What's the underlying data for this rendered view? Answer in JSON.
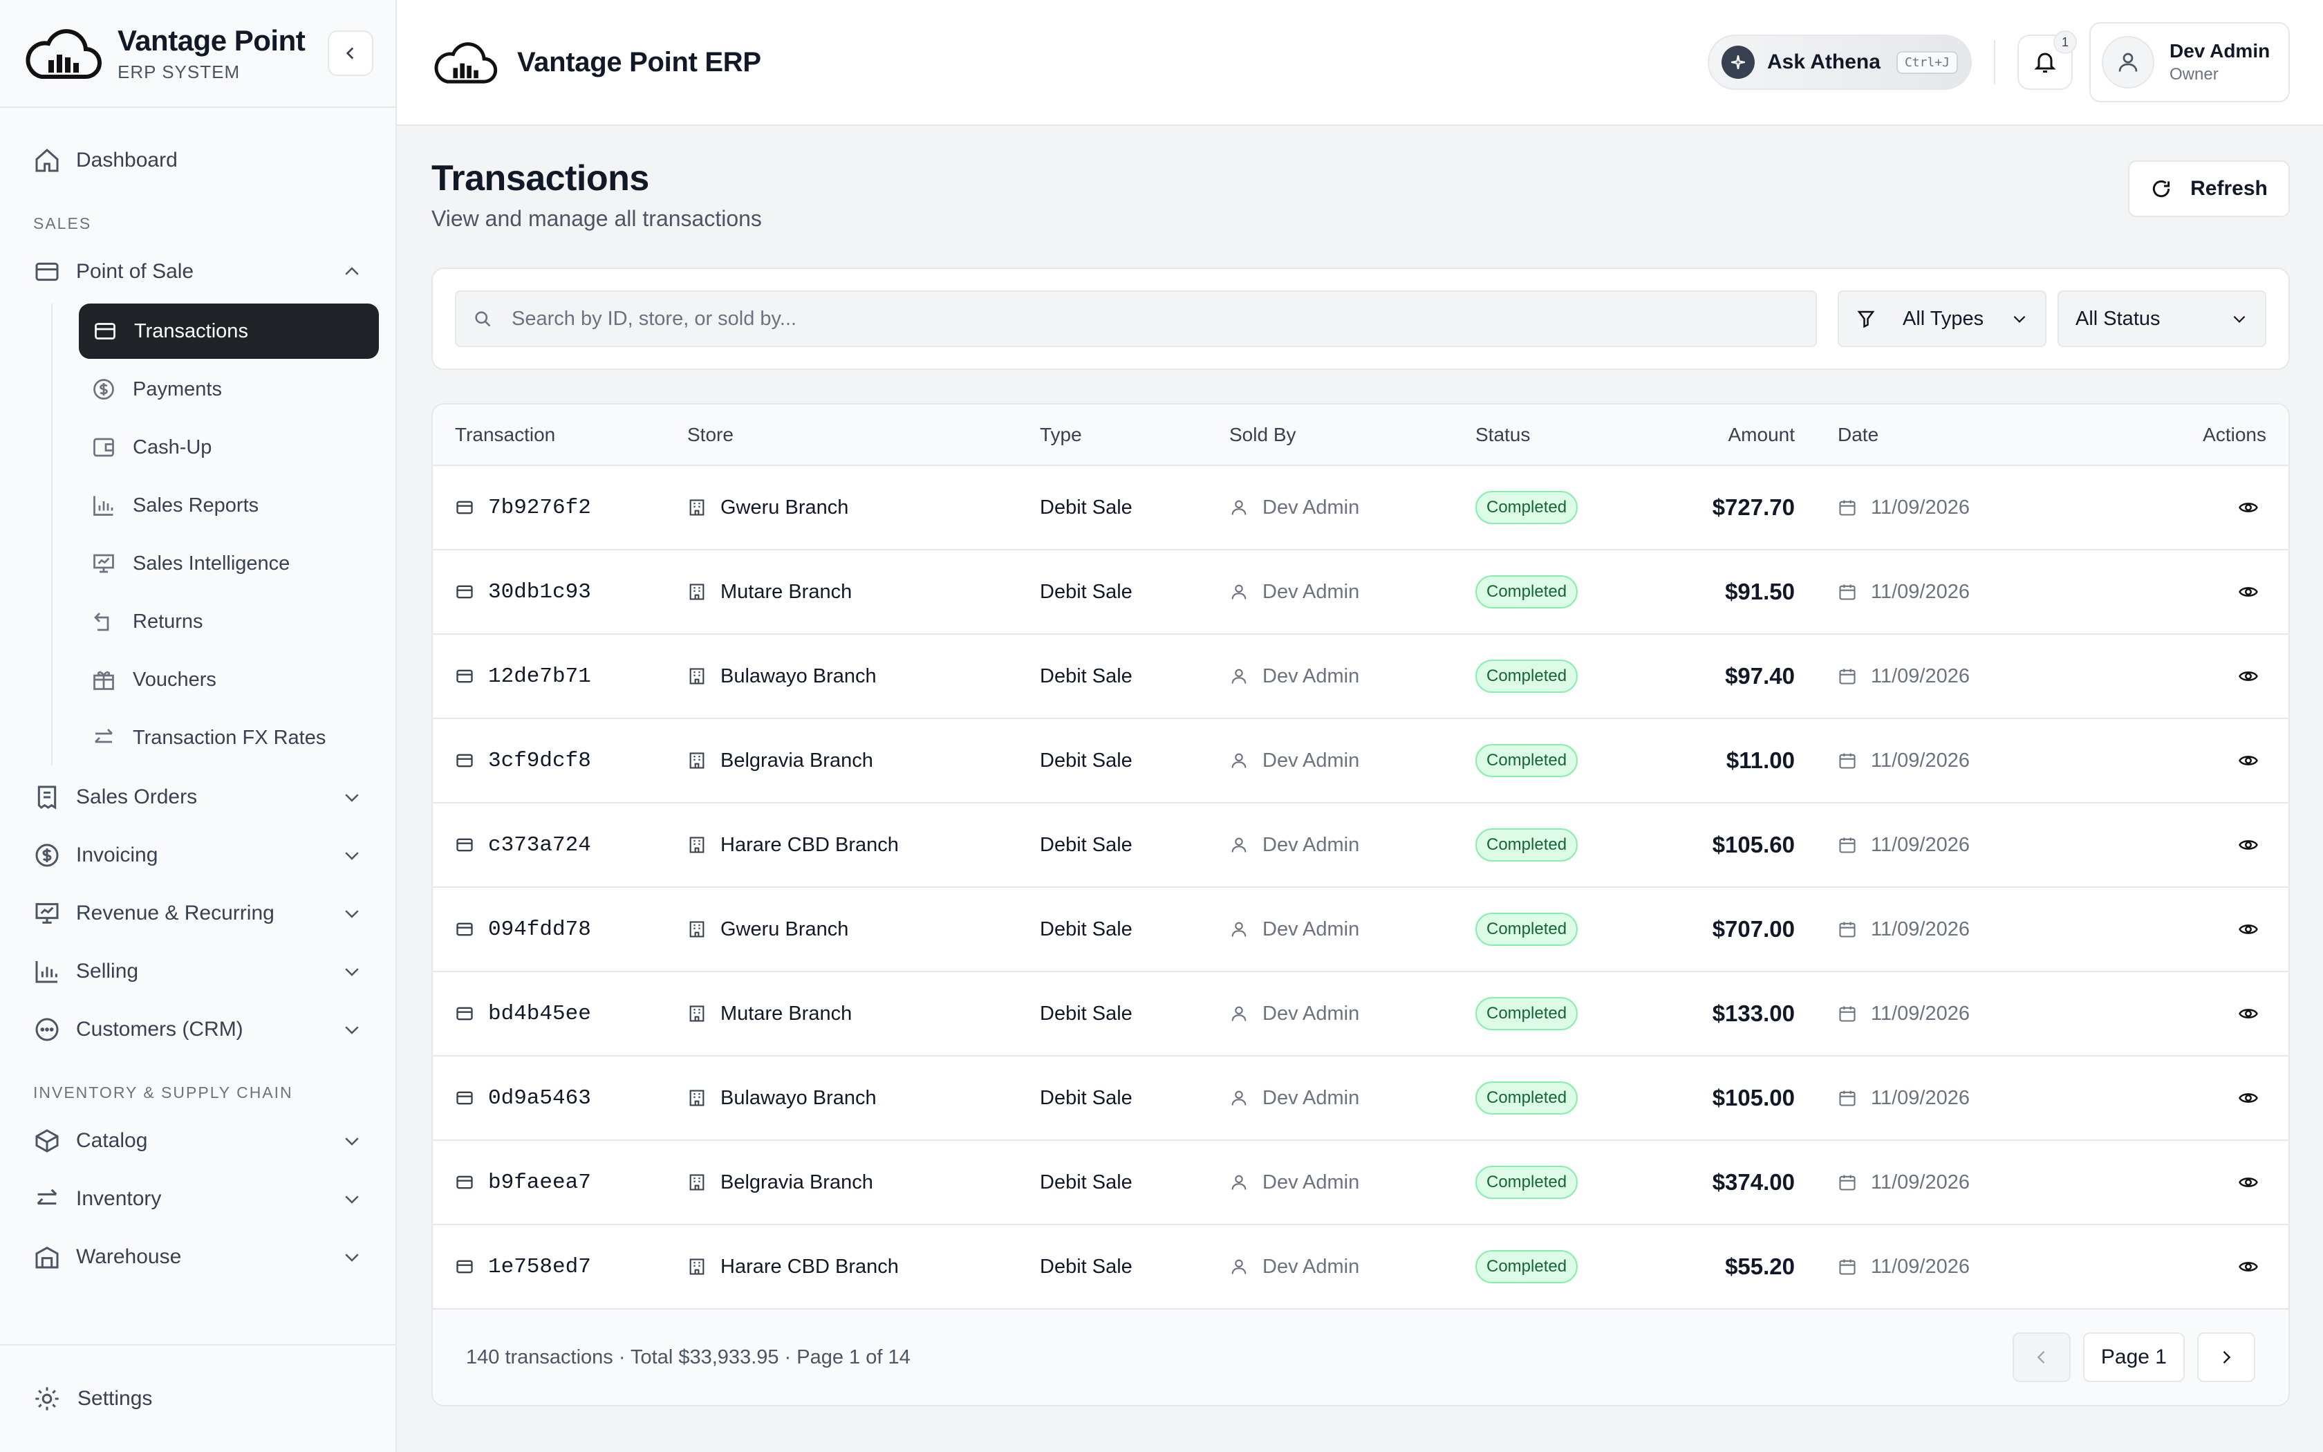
{
  "brand": {
    "name": "Vantage Point",
    "subtitle": "ERP SYSTEM"
  },
  "sidebar": {
    "dashboard": "Dashboard",
    "sections": {
      "sales": "SALES",
      "inventory": "INVENTORY & SUPPLY CHAIN"
    },
    "point_of_sale": "Point of Sale",
    "pos_items": [
      {
        "label": "Transactions",
        "icon": "card-icon"
      },
      {
        "label": "Payments",
        "icon": "dollar-circle-icon"
      },
      {
        "label": "Cash-Up",
        "icon": "wallet-icon"
      },
      {
        "label": "Sales Reports",
        "icon": "bar-chart-icon"
      },
      {
        "label": "Sales Intelligence",
        "icon": "presentation-icon"
      },
      {
        "label": "Returns",
        "icon": "return-arrow-icon"
      },
      {
        "label": "Vouchers",
        "icon": "gift-icon"
      },
      {
        "label": "Transaction FX Rates",
        "icon": "swap-arrows-icon"
      }
    ],
    "groups": [
      {
        "label": "Sales Orders",
        "icon": "receipt-icon"
      },
      {
        "label": "Invoicing",
        "icon": "dollar-circle-icon"
      },
      {
        "label": "Revenue & Recurring",
        "icon": "presentation-icon"
      },
      {
        "label": "Selling",
        "icon": "bar-chart-icon"
      },
      {
        "label": "Customers (CRM)",
        "icon": "chat-icon"
      }
    ],
    "inventory_groups": [
      {
        "label": "Catalog",
        "icon": "box-icon"
      },
      {
        "label": "Inventory",
        "icon": "swap-arrows-icon"
      },
      {
        "label": "Warehouse",
        "icon": "building-icon"
      }
    ],
    "settings": "Settings"
  },
  "header": {
    "title": "Vantage Point ERP",
    "ask_label": "Ask Athena",
    "ask_shortcut": "Ctrl+J",
    "notification_count": "1",
    "user_name": "Dev Admin",
    "user_role": "Owner"
  },
  "page": {
    "title": "Transactions",
    "subtitle": "View and manage all transactions",
    "refresh": "Refresh"
  },
  "filters": {
    "search_placeholder": "Search by ID, store, or sold by...",
    "type_value": "All Types",
    "status_value": "All Status"
  },
  "table": {
    "columns": [
      "Transaction",
      "Store",
      "Type",
      "Sold By",
      "Status",
      "Amount",
      "Date",
      "Actions"
    ],
    "rows": [
      {
        "id": "7b9276f2",
        "store": "Gweru Branch",
        "type": "Debit Sale",
        "sold_by": "Dev Admin",
        "status": "Completed",
        "amount": "$727.70",
        "date": "11/09/2026"
      },
      {
        "id": "30db1c93",
        "store": "Mutare Branch",
        "type": "Debit Sale",
        "sold_by": "Dev Admin",
        "status": "Completed",
        "amount": "$91.50",
        "date": "11/09/2026"
      },
      {
        "id": "12de7b71",
        "store": "Bulawayo Branch",
        "type": "Debit Sale",
        "sold_by": "Dev Admin",
        "status": "Completed",
        "amount": "$97.40",
        "date": "11/09/2026"
      },
      {
        "id": "3cf9dcf8",
        "store": "Belgravia Branch",
        "type": "Debit Sale",
        "sold_by": "Dev Admin",
        "status": "Completed",
        "amount": "$11.00",
        "date": "11/09/2026"
      },
      {
        "id": "c373a724",
        "store": "Harare CBD Branch",
        "type": "Debit Sale",
        "sold_by": "Dev Admin",
        "status": "Completed",
        "amount": "$105.60",
        "date": "11/09/2026"
      },
      {
        "id": "094fdd78",
        "store": "Gweru Branch",
        "type": "Debit Sale",
        "sold_by": "Dev Admin",
        "status": "Completed",
        "amount": "$707.00",
        "date": "11/09/2026"
      },
      {
        "id": "bd4b45ee",
        "store": "Mutare Branch",
        "type": "Debit Sale",
        "sold_by": "Dev Admin",
        "status": "Completed",
        "amount": "$133.00",
        "date": "11/09/2026"
      },
      {
        "id": "0d9a5463",
        "store": "Bulawayo Branch",
        "type": "Debit Sale",
        "sold_by": "Dev Admin",
        "status": "Completed",
        "amount": "$105.00",
        "date": "11/09/2026"
      },
      {
        "id": "b9faeea7",
        "store": "Belgravia Branch",
        "type": "Debit Sale",
        "sold_by": "Dev Admin",
        "status": "Completed",
        "amount": "$374.00",
        "date": "11/09/2026"
      },
      {
        "id": "1e758ed7",
        "store": "Harare CBD Branch",
        "type": "Debit Sale",
        "sold_by": "Dev Admin",
        "status": "Completed",
        "amount": "$55.20",
        "date": "11/09/2026"
      }
    ],
    "footer_summary": "140 transactions · Total $33,933.95 · Page 1 of 14",
    "page_label": "Page 1"
  },
  "colors": {
    "active_nav_bg": "#1f2328",
    "status_green_bg": "#dcfce7",
    "status_green_text": "#166534"
  }
}
